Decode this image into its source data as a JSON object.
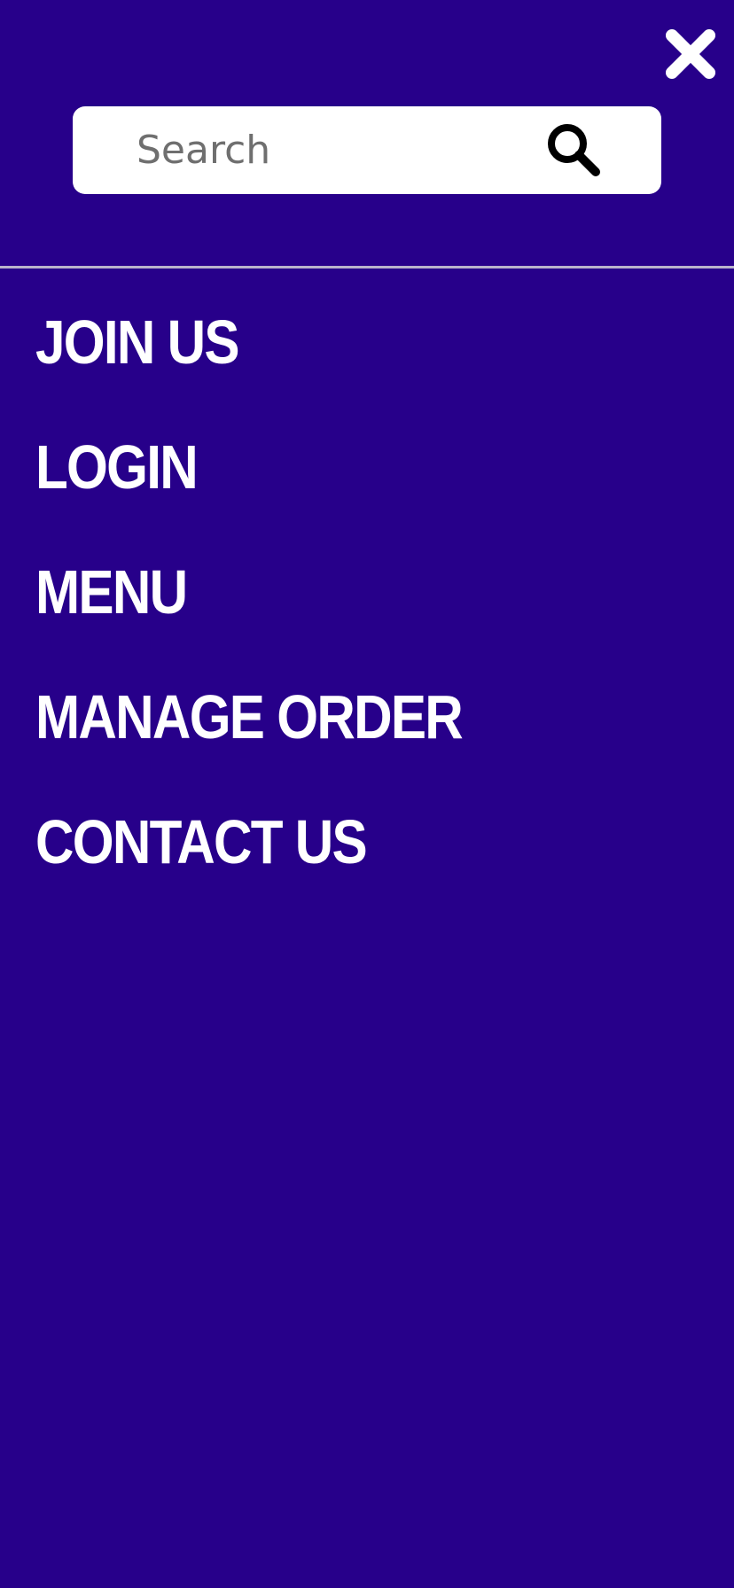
{
  "colors": {
    "background": "#27008a",
    "text": "#ffffff",
    "search_background": "#ffffff",
    "placeholder": "#6f6f6f",
    "divider": "#b9b3cc"
  },
  "header": {
    "close_icon": "close-icon"
  },
  "search": {
    "placeholder": "Search",
    "value": "",
    "icon": "search-icon"
  },
  "nav": {
    "items": [
      {
        "label": "JOIN US"
      },
      {
        "label": "LOGIN"
      },
      {
        "label": "MENU"
      },
      {
        "label": "MANAGE ORDER"
      },
      {
        "label": "CONTACT US"
      }
    ]
  }
}
